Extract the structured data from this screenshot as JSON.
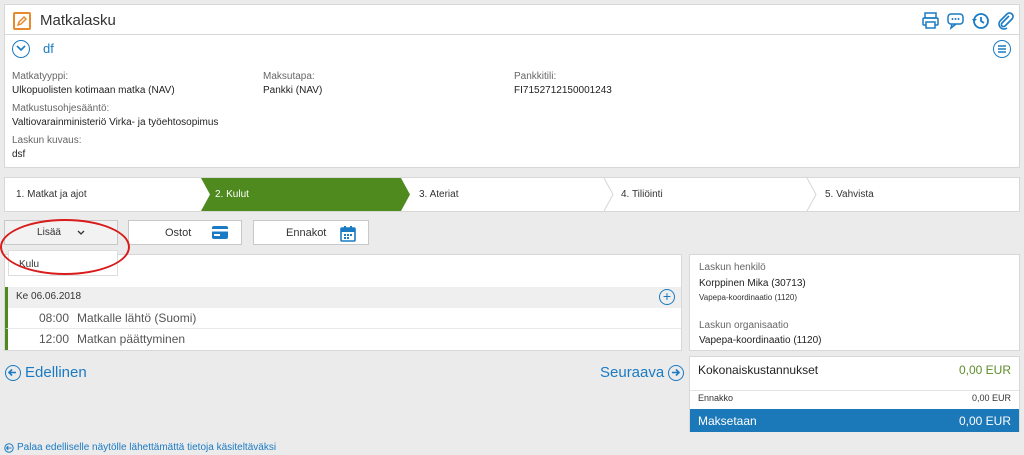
{
  "header": {
    "title": "Matkalasku",
    "icons": [
      "print-icon",
      "comment-icon",
      "history-icon",
      "attachment-icon"
    ]
  },
  "details": {
    "name": "df",
    "fields": {
      "trip_type_label": "Matkatyyppi:",
      "trip_type_value": "Ulkopuolisten kotimaan matka (NAV)",
      "payment_label": "Maksutapa:",
      "payment_value": "Pankki (NAV)",
      "bank_label": "Pankkitili:",
      "bank_value": "FI7152712150001243",
      "rule_label": "Matkustusohjesääntö:",
      "rule_value": "Valtiovarainministeriö Virka- ja työehtosopimus",
      "desc_label": "Laskun kuvaus:",
      "desc_value": "dsf"
    }
  },
  "steps": [
    {
      "label": "1. Matkat ja ajot",
      "active": false
    },
    {
      "label": "2. Kulut",
      "active": true
    },
    {
      "label": "3. Ateriat",
      "active": false
    },
    {
      "label": "4. Tiliöinti",
      "active": false
    },
    {
      "label": "5. Vahvista",
      "active": false
    }
  ],
  "buttons": {
    "add_label": "Lisää",
    "purchases_label": "Ostot",
    "advances_label": "Ennakot"
  },
  "dropdown": {
    "item": "Kulu"
  },
  "timeline": {
    "day": "Ke 06.06.2018",
    "events": [
      {
        "time": "08:00",
        "desc": "Matkalle lähtö  (Suomi)"
      },
      {
        "time": "12:00",
        "desc": "Matkan päättyminen"
      }
    ]
  },
  "nav": {
    "prev": "Edellinen",
    "next": "Seuraava",
    "back": "Palaa edelliselle näytölle lähettämättä tietoja käsiteltäväksi"
  },
  "person": {
    "person_label": "Laskun henkilö",
    "person_name": "Korppinen Mika (30713)",
    "person_unit": "Vapepa-koordinaatio (1120)",
    "org_label": "Laskun organisaatio",
    "org_value": "Vapepa-koordinaatio (1120)"
  },
  "summary": {
    "total_label": "Kokonaiskustannukset",
    "total_value": "0,00 EUR",
    "advance_label": "Ennakko",
    "advance_value": "0,00 EUR",
    "pay_label": "Maksetaan",
    "pay_value": "0,00 EUR"
  },
  "colors": {
    "accent_blue": "#1a7bc4",
    "active_step": "#4e8a1e",
    "highlight_red": "#d81b1b",
    "pay_bar": "#1b78b9"
  }
}
